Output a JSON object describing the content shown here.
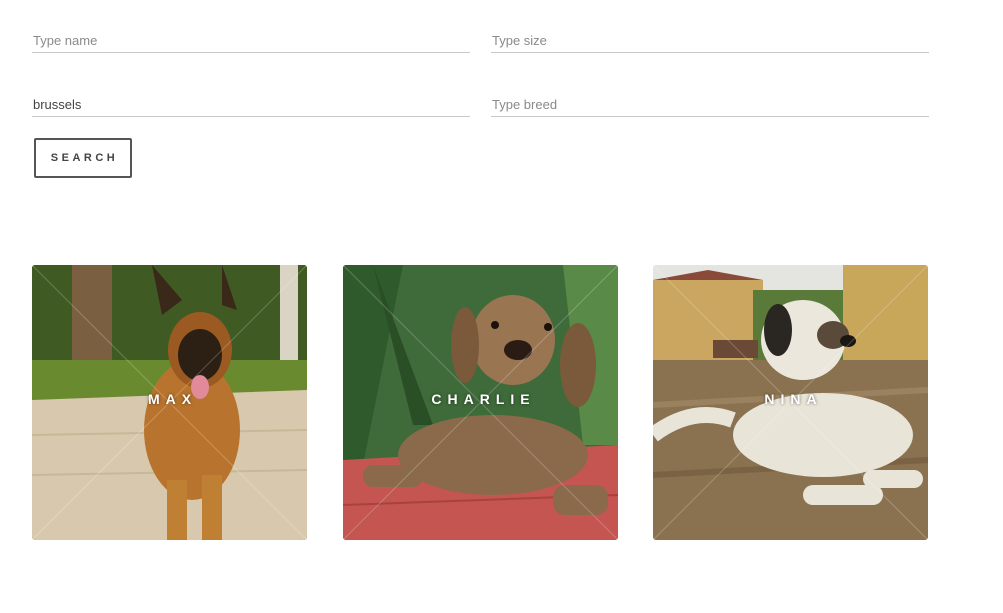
{
  "search_form": {
    "name": {
      "value": "",
      "placeholder": "Type name"
    },
    "size": {
      "value": "",
      "placeholder": "Type size"
    },
    "city": {
      "value": "brussels",
      "placeholder": ""
    },
    "breed": {
      "value": "",
      "placeholder": "Type breed"
    },
    "search_label": "SEARCH"
  },
  "dogs": [
    {
      "name": "MAX"
    },
    {
      "name": "CHARLIE"
    },
    {
      "name": "NINA"
    }
  ],
  "colors": {
    "text": "#555555",
    "border": "#c8c8c8",
    "overlay_text": "#ffffff"
  }
}
